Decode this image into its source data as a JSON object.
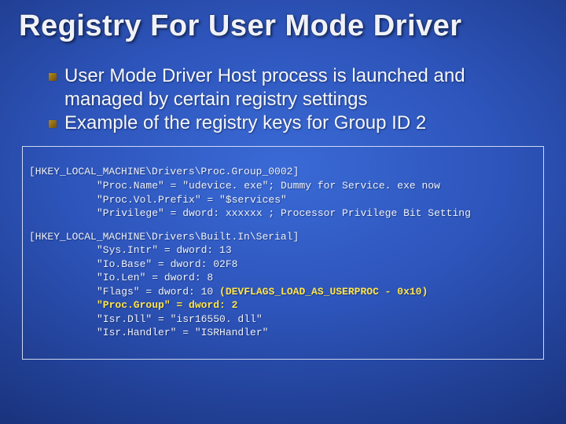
{
  "title": "Registry For User Mode Driver",
  "bullets": [
    "User Mode Driver Host process is launched and managed by certain registry settings",
    "Example of the registry keys for Group ID 2"
  ],
  "code": {
    "block1": {
      "key": "[HKEY_LOCAL_MACHINE\\Drivers\\Proc.Group_0002]",
      "l1": "\"Proc.Name\" = \"udevice. exe\"; Dummy for Service. exe now",
      "l2": "\"Proc.Vol.Prefix\" = \"$services\"",
      "l3": "\"Privilege\" = dword: xxxxxx ; Processor Privilege Bit Setting"
    },
    "block2": {
      "key": "[HKEY_LOCAL_MACHINE\\Drivers\\Built.In\\Serial]",
      "l1": "\"Sys.Intr\" = dword: 13",
      "l2": "\"Io.Base\" = dword: 02F8",
      "l3": "\"Io.Len\" = dword: 8",
      "l4a": "\"Flags\" = dword: 10 ",
      "l4b": "(DEVFLAGS_LOAD_AS_USERPROC - 0x10)",
      "l5": "\"Proc.Group\" = dword: 2",
      "l6": "\"Isr.Dll\" = \"isr16550. dll\"",
      "l7": "\"Isr.Handler\" = \"ISRHandler\""
    }
  }
}
